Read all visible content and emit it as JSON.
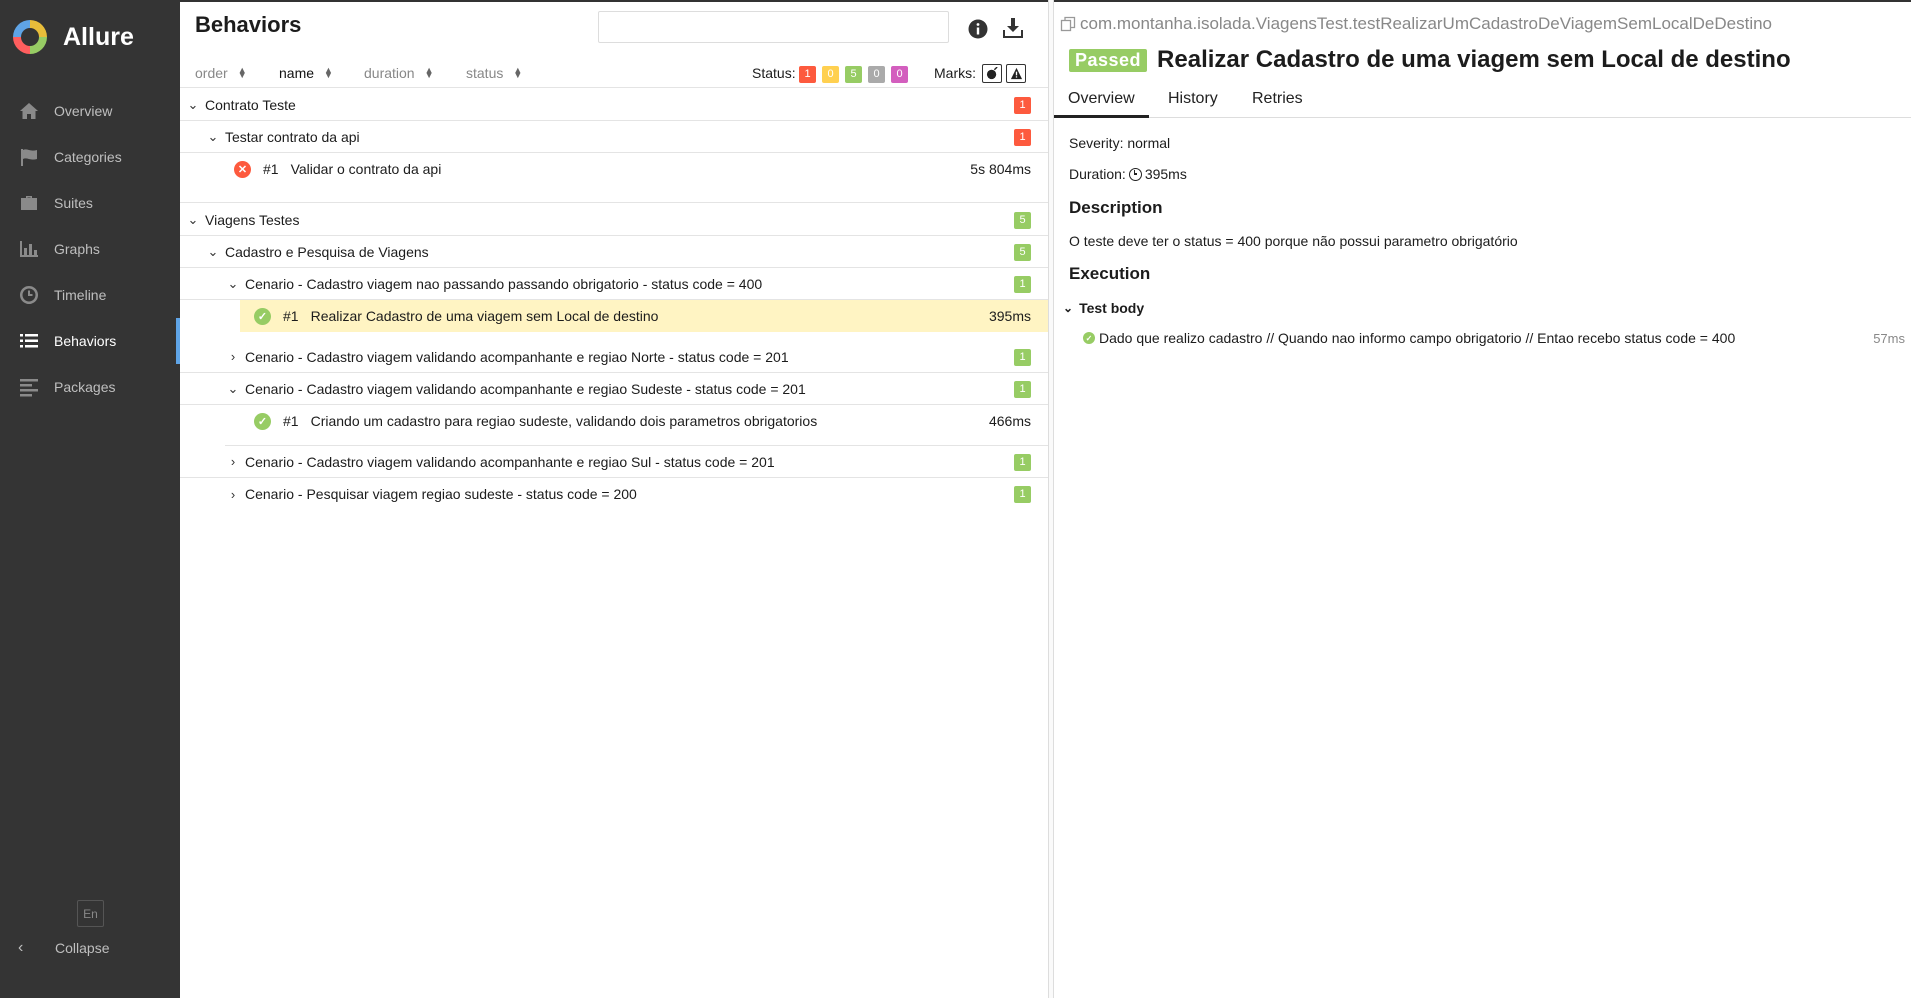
{
  "app": {
    "name": "Allure"
  },
  "sidebar": {
    "items": [
      {
        "label": "Overview",
        "icon": "home-icon"
      },
      {
        "label": "Categories",
        "icon": "flag-icon"
      },
      {
        "label": "Suites",
        "icon": "briefcase-icon"
      },
      {
        "label": "Graphs",
        "icon": "bar-chart-icon"
      },
      {
        "label": "Timeline",
        "icon": "clock-icon"
      },
      {
        "label": "Behaviors",
        "icon": "list-icon",
        "active": true
      },
      {
        "label": "Packages",
        "icon": "align-left-icon"
      }
    ],
    "language": "En",
    "collapse_label": "Collapse"
  },
  "tree_pane": {
    "title": "Behaviors",
    "search_value": "",
    "sort": {
      "order": "order",
      "name": "name",
      "duration": "duration",
      "status": "status"
    },
    "status_label": "Status:",
    "status_counts": {
      "failed": "1",
      "broken": "0",
      "passed": "5",
      "skipped": "0",
      "unknown": "0"
    },
    "marks_label": "Marks:",
    "colors": {
      "failed": "#fd5a3e",
      "broken": "#ffd050",
      "passed": "#97cc64",
      "skipped": "#aaaaaa",
      "unknown": "#d35ebe",
      "selected_row": "#fff4c3"
    },
    "rows": [
      {
        "label": "Contrato Teste",
        "count": "1"
      },
      {
        "label": "Testar contrato da api",
        "count": "1"
      },
      {
        "num": "#1",
        "label": "Validar o contrato da api",
        "duration": "5s 804ms",
        "status": "failed"
      },
      {
        "label": "Viagens Testes",
        "count": "5"
      },
      {
        "label": "Cadastro e Pesquisa de Viagens",
        "count": "5"
      },
      {
        "label": "Cenario - Cadastro viagem nao passando passando obrigatorio - status code = 400",
        "count": "1"
      },
      {
        "num": "#1",
        "label": "Realizar Cadastro de uma viagem sem Local de destino",
        "duration": "395ms",
        "status": "passed",
        "selected": true
      },
      {
        "label": "Cenario - Cadastro viagem validando acompanhante e regiao Norte - status code = 201",
        "count": "1"
      },
      {
        "label": "Cenario - Cadastro viagem validando acompanhante e regiao Sudeste - status code = 201",
        "count": "1"
      },
      {
        "num": "#1",
        "label": "Criando um cadastro para regiao sudeste, validando dois parametros obrigatorios",
        "duration": "466ms",
        "status": "passed"
      },
      {
        "label": "Cenario - Cadastro viagem validando acompanhante e regiao Sul - status code = 201",
        "count": "1"
      },
      {
        "label": "Cenario - Pesquisar viagem regiao sudeste - status code = 200",
        "count": "1"
      }
    ]
  },
  "detail": {
    "full_name": "com.montanha.isolada.ViagensTest.testRealizarUmCadastroDeViagemSemLocalDeDestino",
    "status": "Passed",
    "title": "Realizar Cadastro de uma viagem sem Local de destino",
    "tabs": [
      "Overview",
      "History",
      "Retries"
    ],
    "severity": "Severity: normal",
    "duration_label": "Duration:",
    "duration": "395ms",
    "description_heading": "Description",
    "description": "O teste deve ter o status = 400 porque não possui parametro obrigatório",
    "execution_heading": "Execution",
    "test_body_label": "Test body",
    "step": {
      "label": "Dado que realizo cadastro // Quando nao informo campo obrigatorio // Entao recebo status code = 400",
      "duration": "57ms"
    }
  }
}
